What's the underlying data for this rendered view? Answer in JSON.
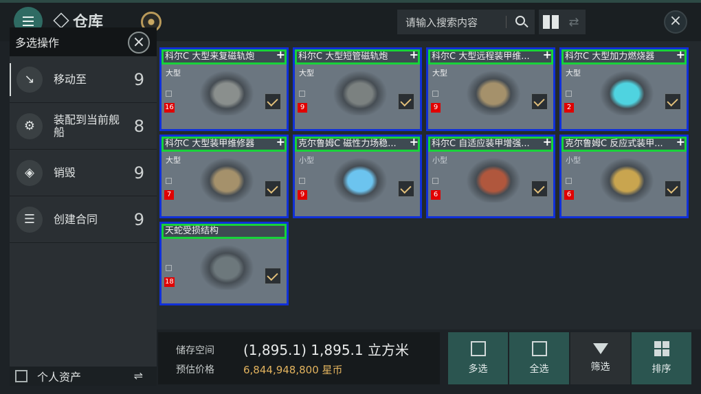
{
  "header": {
    "title": "仓库",
    "search_placeholder": "请输入搜索内容"
  },
  "side_panel": {
    "title": "多选操作",
    "items": [
      {
        "label": "移动至",
        "count": "9",
        "icon": "move-icon"
      },
      {
        "label": "装配到当前舰船",
        "count": "8",
        "icon": "fit-ship-icon"
      },
      {
        "label": "销毁",
        "count": "9",
        "icon": "destroy-icon"
      },
      {
        "label": "创建合同",
        "count": "9",
        "icon": "contract-icon"
      }
    ],
    "personal_assets": "个人资产"
  },
  "items": [
    {
      "name": "科尔C 大型来复磁轨炮",
      "size": "大型",
      "qty": "16",
      "color": "#8a8f8d"
    },
    {
      "name": "科尔C 大型短管磁轨炮",
      "size": "大型",
      "qty": "9",
      "color": "#7b8180"
    },
    {
      "name": "科尔C 大型远程装甲维...",
      "size": "大型",
      "qty": "9",
      "color": "#a5916b"
    },
    {
      "name": "科尔C 大型加力燃烧器",
      "size": "大型",
      "qty": "2",
      "color": "#4fd3e0"
    },
    {
      "name": "科尔C 大型装甲维修器",
      "size": "大型",
      "qty": "7",
      "color": "#a5916b"
    },
    {
      "name": "克尔鲁姆C 磁性力场稳...",
      "size": "小型",
      "qty": "9",
      "color": "#6cc4ef"
    },
    {
      "name": "科尔C 自适应装甲增强...",
      "size": "小型",
      "qty": "6",
      "color": "#b0573d"
    },
    {
      "name": "克尔鲁姆C 反应式装甲...",
      "size": "小型",
      "qty": "6",
      "color": "#c9a54f"
    },
    {
      "name": "天蛇受损结构",
      "size": "",
      "qty": "18",
      "color": "#6d787c"
    }
  ],
  "storage": {
    "label_space": "储存空间",
    "space_value": "(1,895.1) 1,895.1 立方米",
    "label_price": "预估价格",
    "price_value": "6,844,948,800 星币"
  },
  "actions": [
    {
      "label": "多选"
    },
    {
      "label": "全选"
    },
    {
      "label": "筛选"
    },
    {
      "label": "排序"
    }
  ]
}
